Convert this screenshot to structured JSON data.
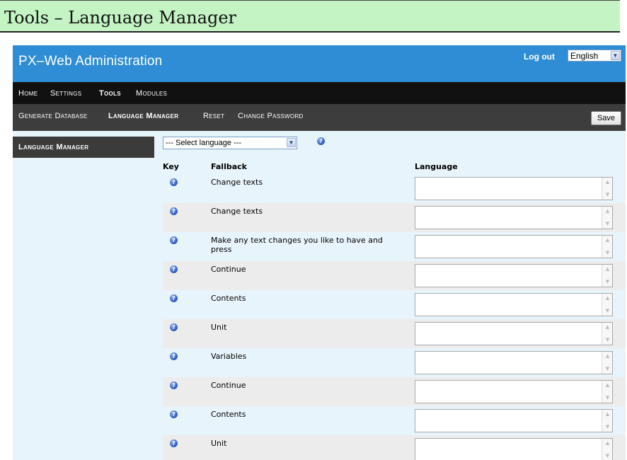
{
  "doc_title": "Tools – Language Manager",
  "header": {
    "app_title": "PX–Web Administration",
    "logout_label": "Log out",
    "language_selected": "English"
  },
  "nav_primary": [
    "Home",
    "Settings",
    "Tools",
    "Modules"
  ],
  "nav_primary_active": "Tools",
  "nav_secondary": [
    "Generate Database",
    "Language Manager",
    "Reset",
    "Change Password"
  ],
  "nav_secondary_active": "Language Manager",
  "save_label": "Save",
  "sidebar": {
    "label": "Language Manager"
  },
  "language_select": {
    "value": "--- Select language ---"
  },
  "columns": {
    "key": "Key",
    "fallback": "Fallback",
    "language": "Language"
  },
  "rows": [
    {
      "fallback": "Change texts"
    },
    {
      "fallback": "Change texts"
    },
    {
      "fallback": "Make any text changes you like to have and press"
    },
    {
      "fallback": "Continue"
    },
    {
      "fallback": "Contents"
    },
    {
      "fallback": "Unit"
    },
    {
      "fallback": "Variables"
    },
    {
      "fallback": "Continue"
    },
    {
      "fallback": "Contents"
    },
    {
      "fallback": "Unit"
    }
  ],
  "colors": {
    "title_bar": "#c4f4c4",
    "header_blue": "#2e8dd4",
    "nav_primary_bg": "#111111",
    "nav_secondary_bg": "#3d3d3d",
    "content_bg": "#e8f4fc",
    "row_alt_bg": "#ececec"
  },
  "icons": {
    "help": "question-circle-icon",
    "dropdown": "chevron-down-icon"
  }
}
